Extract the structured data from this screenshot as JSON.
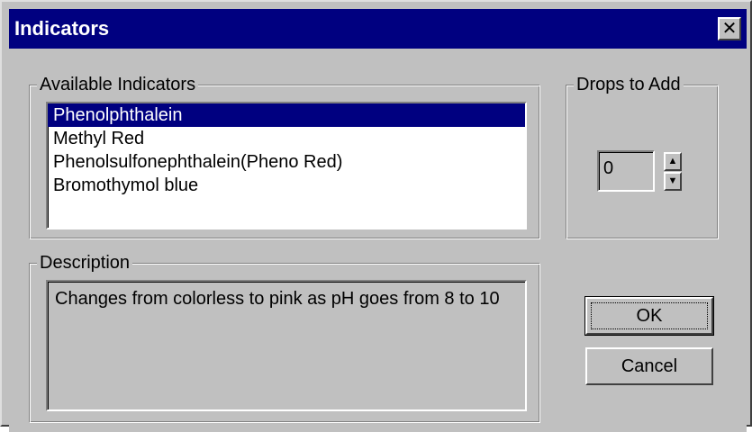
{
  "window": {
    "title": "Indicators",
    "close_glyph": "✕"
  },
  "available_indicators": {
    "label": "Available Indicators",
    "items": [
      {
        "label": "Phenolphthalein",
        "selected": true
      },
      {
        "label": "Methyl Red",
        "selected": false
      },
      {
        "label": "Phenolsulfonephthalein(Pheno Red)",
        "selected": false
      },
      {
        "label": "Bromothymol blue",
        "selected": false
      }
    ]
  },
  "drops_to_add": {
    "label": "Drops to Add",
    "value": "0",
    "up_glyph": "▲",
    "down_glyph": "▼"
  },
  "description": {
    "label": "Description",
    "text": "Changes from colorless to pink as pH goes from 8 to 10"
  },
  "buttons": {
    "ok_label": "OK",
    "cancel_label": "Cancel"
  },
  "colors": {
    "titlebar": "#000080",
    "face": "#c0c0c0",
    "selection": "#000080"
  },
  "icons": {
    "close": "close-icon",
    "spin_up": "arrow-up-icon",
    "spin_down": "arrow-down-icon"
  }
}
